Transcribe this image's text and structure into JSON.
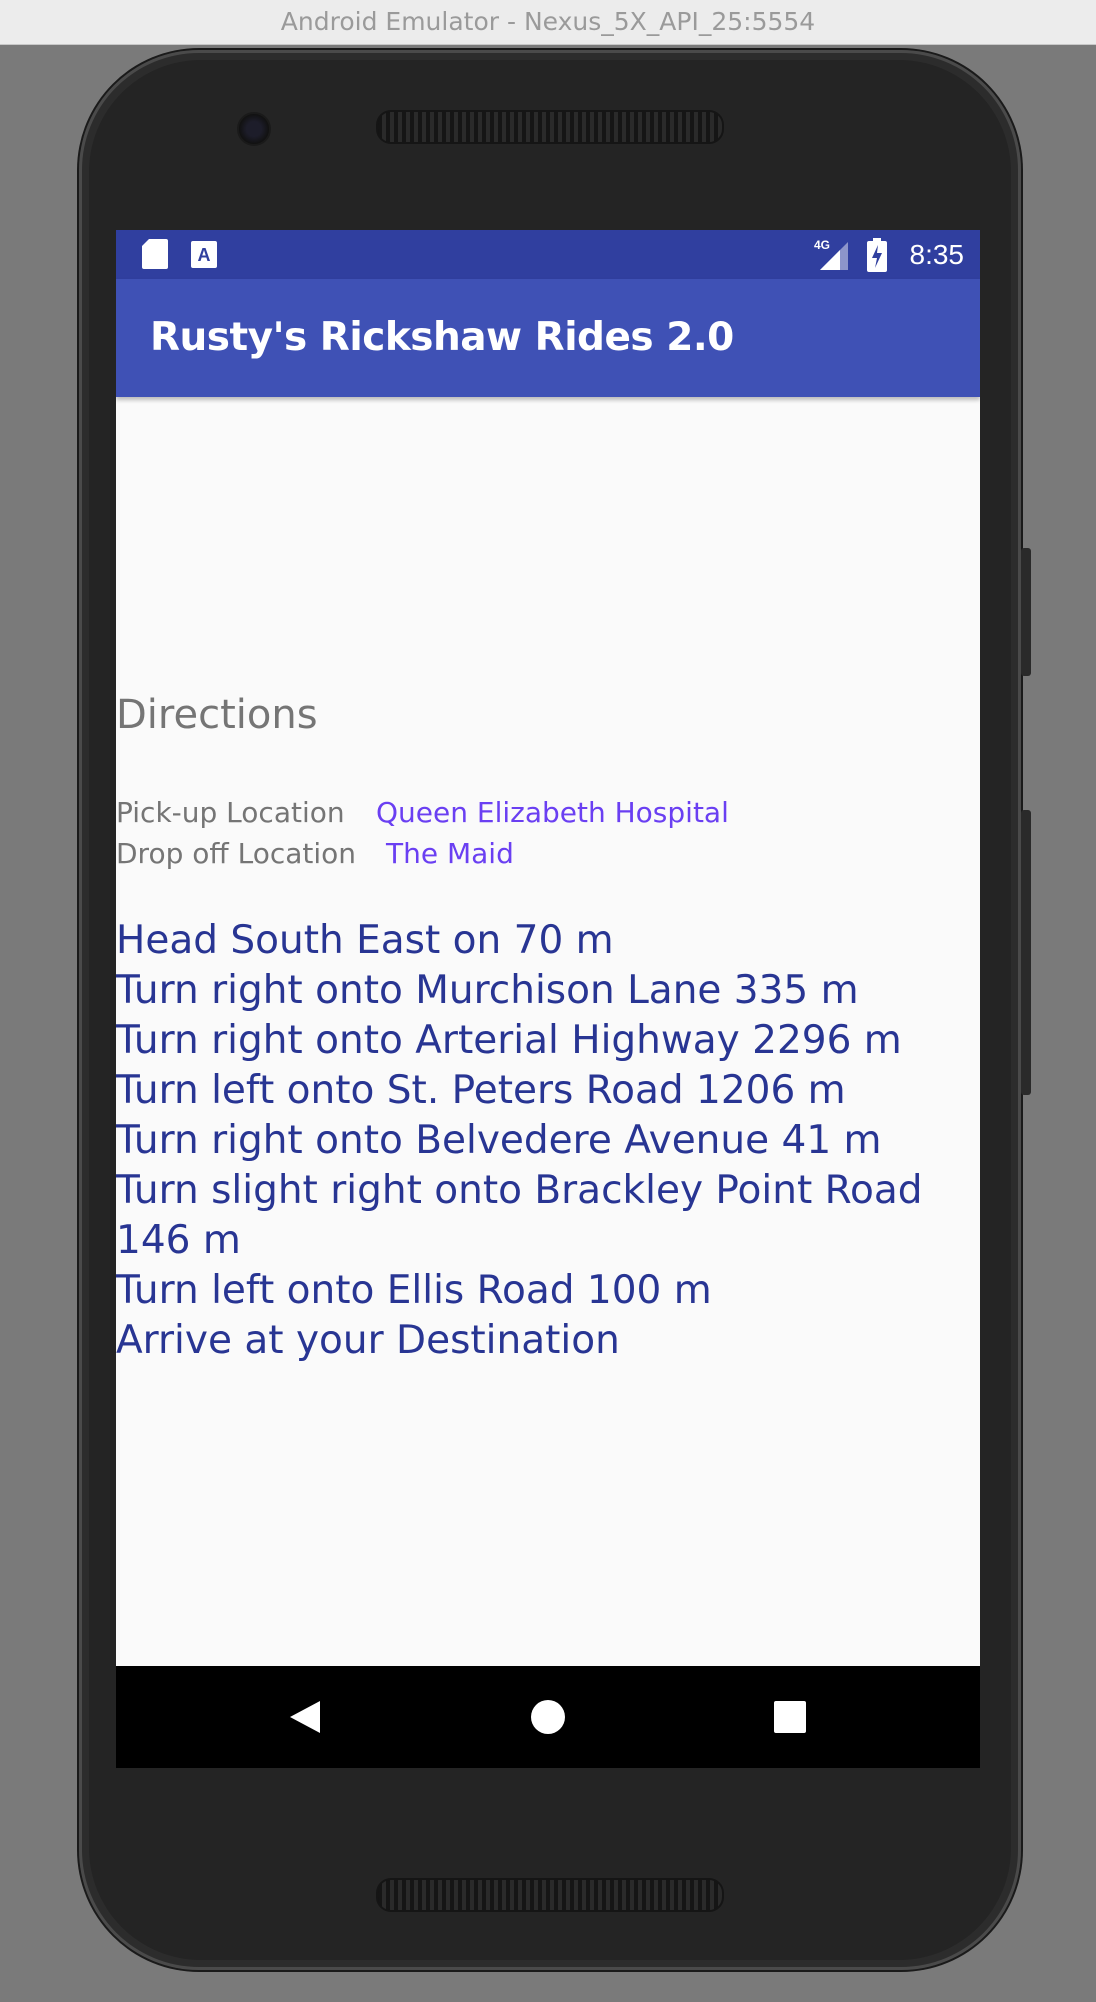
{
  "window": {
    "title": "Android Emulator - Nexus_5X_API_25:5554"
  },
  "status_bar": {
    "time": "8:35",
    "network": "4G",
    "icons": [
      "sd-card-icon",
      "keyboard-a-icon",
      "signal-4g-icon",
      "battery-charging-icon"
    ]
  },
  "app_bar": {
    "title": "Rusty's Rickshaw Rides 2.0"
  },
  "main": {
    "heading": "Directions",
    "pickup_label": "Pick-up Location",
    "pickup_value": "Queen Elizabeth Hospital",
    "dropoff_label": "Drop off Location",
    "dropoff_value": "The Maid",
    "steps": [
      "Head South East on  70 m",
      "Turn right onto Murchison Lane 335 m",
      "Turn right onto Arterial Highway 2296 m",
      "Turn left onto St. Peters Road 1206 m",
      "Turn right onto Belvedere Avenue 41 m",
      "Turn slight right onto Brackley Point Road 146 m",
      "Turn left onto Ellis Road 100 m",
      "Arrive at your Destination"
    ]
  },
  "nav_bar": {
    "buttons": [
      "back-icon",
      "home-icon",
      "recents-icon"
    ]
  },
  "colors": {
    "status_bar": "#303f9f",
    "app_bar": "#3f51b5",
    "step_text": "#283593",
    "link_text": "#6a3ff2",
    "label_text": "#757575"
  }
}
